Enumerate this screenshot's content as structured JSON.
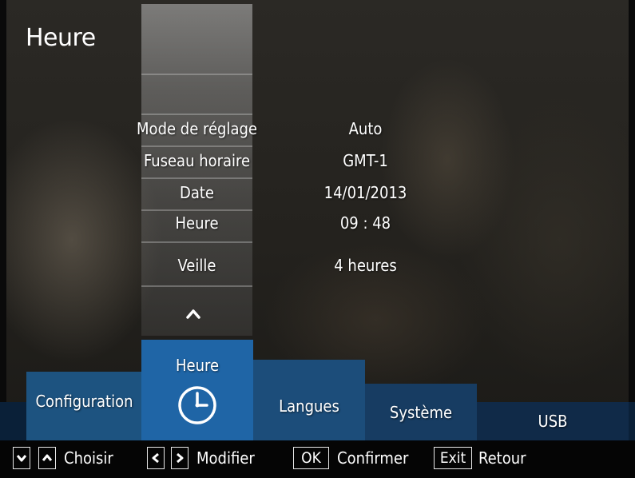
{
  "page": {
    "title": "Heure"
  },
  "settings": [
    {
      "label": "Mode de réglage",
      "value": "Auto"
    },
    {
      "label": "Fuseau horaire",
      "value": "GMT-1"
    },
    {
      "label": "Date",
      "value": "14/01/2013"
    },
    {
      "label": "Heure",
      "value": "09 : 48"
    },
    {
      "label": "Veille",
      "value": "4 heures"
    }
  ],
  "tabs": [
    {
      "label": "Configuration"
    },
    {
      "label": "Heure",
      "icon": "clock-icon",
      "selected": true
    },
    {
      "label": "Langues"
    },
    {
      "label": "Système"
    },
    {
      "label": "USB"
    }
  ],
  "help": {
    "choose": "Choisir",
    "modify": "Modifier",
    "ok_key": "OK",
    "confirm": "Confirmer",
    "exit_key": "Exit",
    "back": "Retour"
  },
  "colors": {
    "selected_tab": "#1f65a6",
    "tab_blue": "#1d5380",
    "tab_strip": "#0a2038",
    "help_bar": "#050505"
  }
}
